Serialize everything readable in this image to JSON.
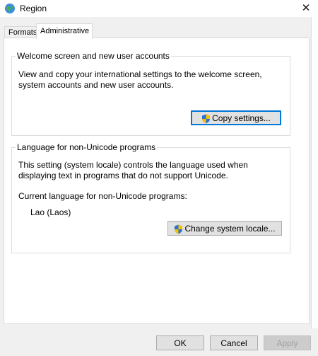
{
  "window": {
    "title": "Region",
    "close_glyph": "✕"
  },
  "tabs": [
    {
      "label": "Formats",
      "active": false
    },
    {
      "label": "Administrative",
      "active": true
    }
  ],
  "welcome": {
    "legend": "Welcome screen and new user accounts",
    "description": "View and copy your international settings to the welcome screen, system accounts and new user accounts.",
    "copy_button": "Copy settings..."
  },
  "nonunicode": {
    "legend": "Language for non-Unicode programs",
    "description": "This setting (system locale) controls the language used when displaying text in programs that do not support Unicode.",
    "current_label": "Current language for non-Unicode programs:",
    "current_value": "Lao (Laos)",
    "change_button": "Change system locale..."
  },
  "footer": {
    "ok": "OK",
    "cancel": "Cancel",
    "apply": "Apply"
  },
  "colors": {
    "focus": "#0078d7",
    "shield_blue": "#2a6fd6",
    "shield_yellow": "#f5c400"
  }
}
